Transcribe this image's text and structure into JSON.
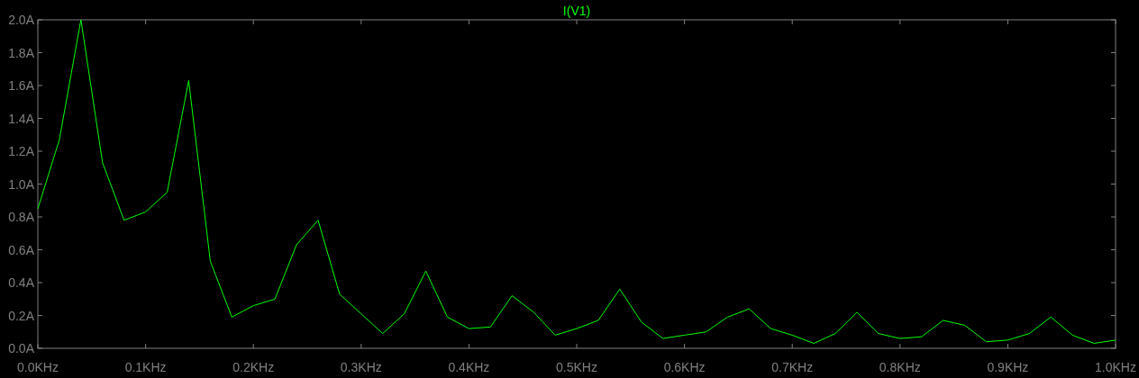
{
  "chart_data": {
    "type": "line",
    "title": "I(V1)",
    "x": [
      0,
      0.02,
      0.04,
      0.06,
      0.08,
      0.1,
      0.12,
      0.14,
      0.16,
      0.18,
      0.2,
      0.22,
      0.24,
      0.26,
      0.28,
      0.3,
      0.32,
      0.34,
      0.36,
      0.38,
      0.4,
      0.42,
      0.44,
      0.46,
      0.48,
      0.5,
      0.52,
      0.54,
      0.56,
      0.58,
      0.6,
      0.62,
      0.64,
      0.66,
      0.68,
      0.7,
      0.72,
      0.74,
      0.76,
      0.78,
      0.8,
      0.82,
      0.84,
      0.86,
      0.88,
      0.9,
      0.92,
      0.94,
      0.96,
      0.98,
      1.0
    ],
    "series": [
      {
        "color": "#00ff00",
        "values": [
          0.85,
          1.27,
          2.0,
          1.13,
          0.78,
          0.83,
          0.95,
          1.63,
          0.53,
          0.19,
          0.26,
          0.3,
          0.63,
          0.78,
          0.33,
          0.21,
          0.09,
          0.21,
          0.47,
          0.19,
          0.12,
          0.13,
          0.32,
          0.22,
          0.08,
          0.12,
          0.17,
          0.36,
          0.16,
          0.06,
          0.08,
          0.1,
          0.19,
          0.24,
          0.12,
          0.08,
          0.03,
          0.09,
          0.22,
          0.09,
          0.06,
          0.07,
          0.17,
          0.14,
          0.04,
          0.05,
          0.09,
          0.19,
          0.08,
          0.03,
          0.05
        ]
      }
    ],
    "xlim": [
      0,
      1.0
    ],
    "ylim": [
      0,
      2
    ],
    "xticks": [
      {
        "value": 0,
        "label": "0.0KHz"
      },
      {
        "value": 0.1,
        "label": "0.1KHz"
      },
      {
        "value": 0.2,
        "label": "0.2KHz"
      },
      {
        "value": 0.3,
        "label": "0.3KHz"
      },
      {
        "value": 0.4,
        "label": "0.4KHz"
      },
      {
        "value": 0.5,
        "label": "0.5KHz"
      },
      {
        "value": 0.6,
        "label": "0.6KHz"
      },
      {
        "value": 0.7,
        "label": "0.7KHz"
      },
      {
        "value": 0.8,
        "label": "0.8KHz"
      },
      {
        "value": 0.9,
        "label": "0.9KHz"
      },
      {
        "value": 1.0,
        "label": "1.0KHz"
      }
    ],
    "yticks": [
      {
        "value": 0,
        "label": "0.0A"
      },
      {
        "value": 0.2,
        "label": "0.2A"
      },
      {
        "value": 0.4,
        "label": "0.4A"
      },
      {
        "value": 0.6,
        "label": "0.6A"
      },
      {
        "value": 0.8,
        "label": "0.8A"
      },
      {
        "value": 1.0,
        "label": "1.0A"
      },
      {
        "value": 1.2,
        "label": "1.2A"
      },
      {
        "value": 1.4,
        "label": "1.4A"
      },
      {
        "value": 1.6,
        "label": "1.6A"
      },
      {
        "value": 1.8,
        "label": "1.8A"
      },
      {
        "value": 2.0,
        "label": "2.0A"
      }
    ]
  }
}
